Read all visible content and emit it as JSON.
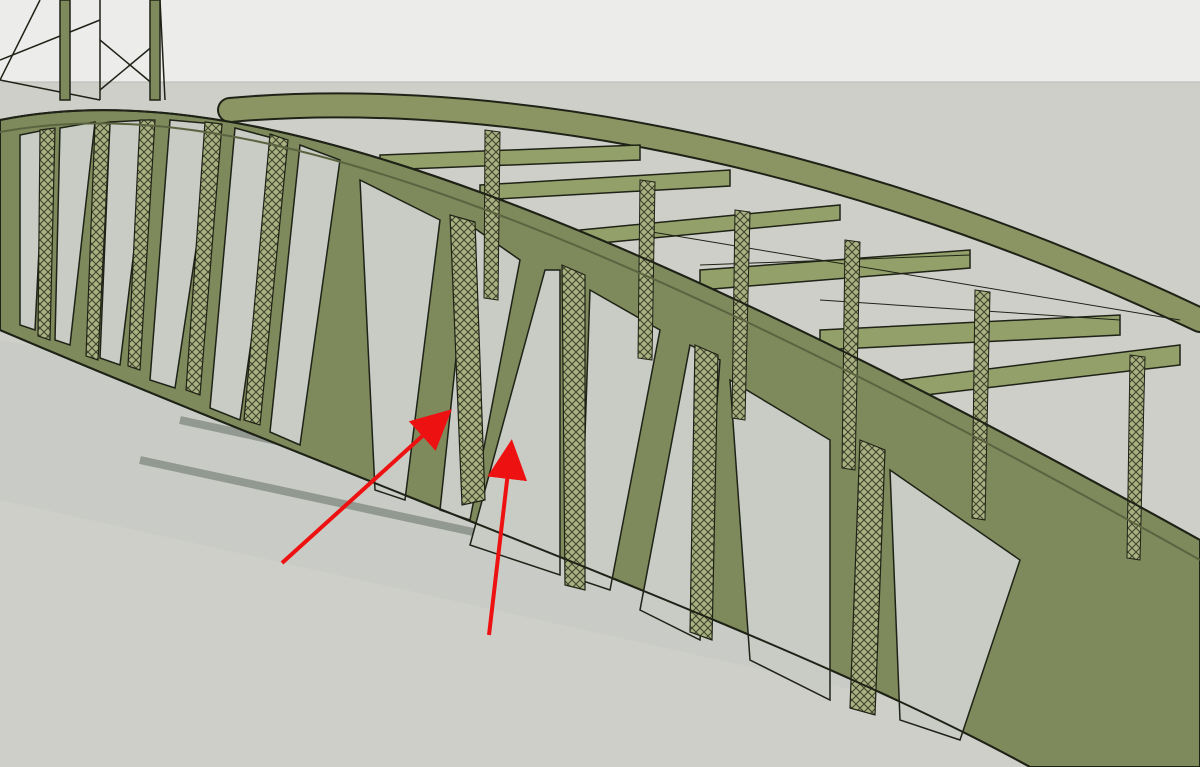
{
  "scene": {
    "subject": "truss-bridge-3d-model",
    "colors": {
      "sky": "#ececea",
      "ground": "#cfcfc9",
      "deck_shadow": "#b9bdba",
      "steel": "#7f8a5c",
      "steel_light": "#93a06a",
      "steel_shadow": "#5b6340",
      "lattice": "#a9b081",
      "outline": "#1f2216",
      "annotation": "#ee1111"
    },
    "annotations": [
      {
        "name": "arrow-1",
        "meaning": "pointer-arrow"
      },
      {
        "name": "arrow-2",
        "meaning": "pointer-arrow"
      }
    ]
  }
}
